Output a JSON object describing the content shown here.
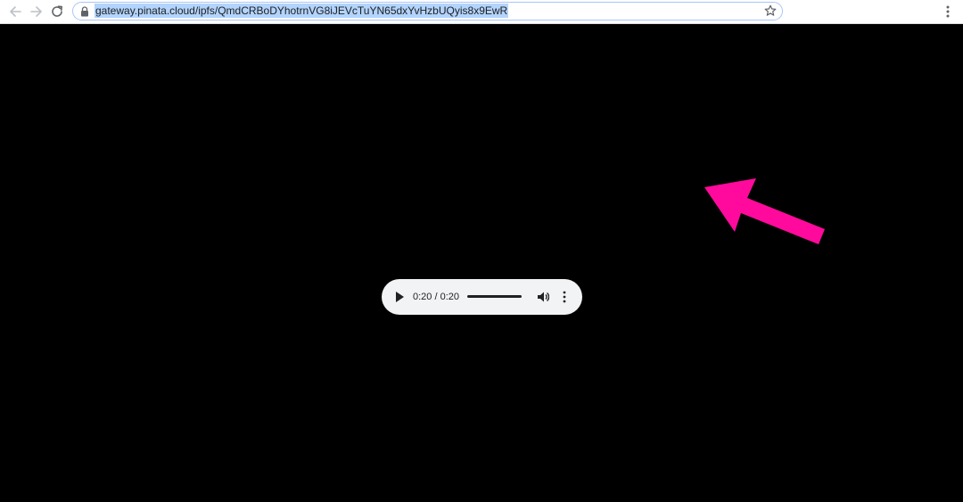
{
  "browser": {
    "url": "gateway.pinata.cloud/ipfs/QmdCRBoDYhotrnVG8iJEVcTuYN65dxYvHzbUQyis8x9EwR",
    "colors": {
      "toolbar_bg": "#ffffff",
      "omnibox_border": "#a8c7fa",
      "selection": "#b3d4fc",
      "icon": "#5f6368",
      "icon_disabled": "#bdc1c6"
    },
    "icons": {
      "back": "arrow-left-icon",
      "forward": "arrow-right-icon",
      "reload": "reload-icon",
      "lock": "lock-icon",
      "bookmark": "star-outline-icon",
      "menu": "three-dots-vertical-icon"
    }
  },
  "page": {
    "background": "#000000",
    "annotation_arrow_color": "#ff0a9c"
  },
  "audio_player": {
    "time_display": "0:20 / 0:20",
    "progress": 1.0,
    "background": "#f1f3f4",
    "icons": {
      "play": "play-icon",
      "volume": "volume-icon",
      "more": "more-vertical-icon"
    }
  }
}
